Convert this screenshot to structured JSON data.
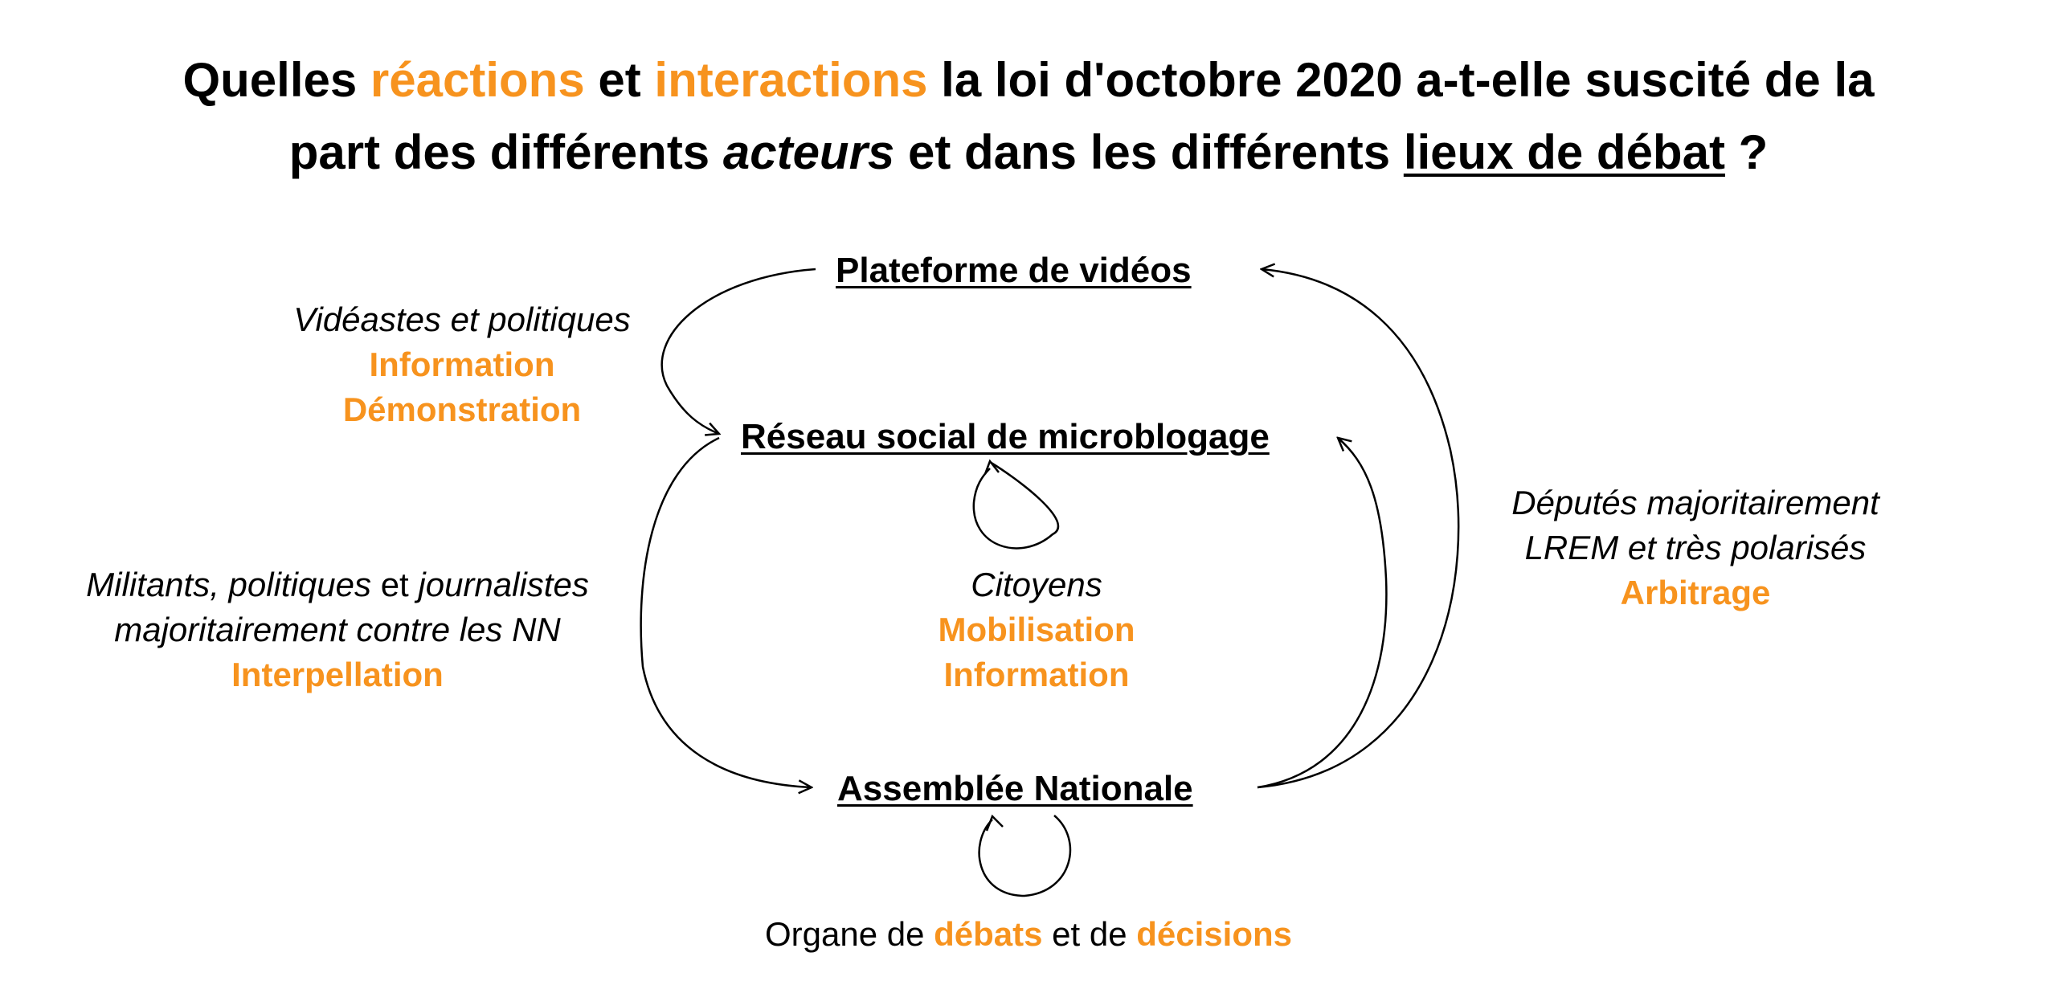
{
  "title": {
    "l1_a": "Quelles ",
    "l1_b": "réactions",
    "l1_c": " et ",
    "l1_d": "interactions",
    "l1_e": " la loi d'octobre 2020 a-t-elle suscité de la",
    "l2_a": "part des différents ",
    "l2_b": "acteurs",
    "l2_c": " et dans les différents ",
    "l2_d": "lieux de débat",
    "l2_e": " ?"
  },
  "nodes": {
    "platform": "Plateforme de vidéos",
    "microblog": "Réseau social de microblogage",
    "assembly": "Assemblée Nationale"
  },
  "notes": {
    "left_top": {
      "actors": "Vidéastes et politiques",
      "role1": "Information",
      "role2": "Démonstration"
    },
    "left_mid": {
      "actors_a": "Militants",
      "actors_b": ", politiques ",
      "actors_c": "et",
      "actors_d": " journalistes",
      "actors2": "majoritairement contre les NN",
      "role": "Interpellation"
    },
    "center": {
      "actors": "Citoyens",
      "role1": "Mobilisation",
      "role2": "Information"
    },
    "right": {
      "actors1": "Députés majoritairement",
      "actors2": "LREM et très polarisés",
      "role": "Arbitrage"
    },
    "bottom": {
      "a": "Organe de ",
      "b": "débats",
      "c": " et de ",
      "d": "décisions"
    }
  },
  "colors": {
    "accent": "#F7931E",
    "text": "#000000",
    "background": "#FFFFFF"
  }
}
